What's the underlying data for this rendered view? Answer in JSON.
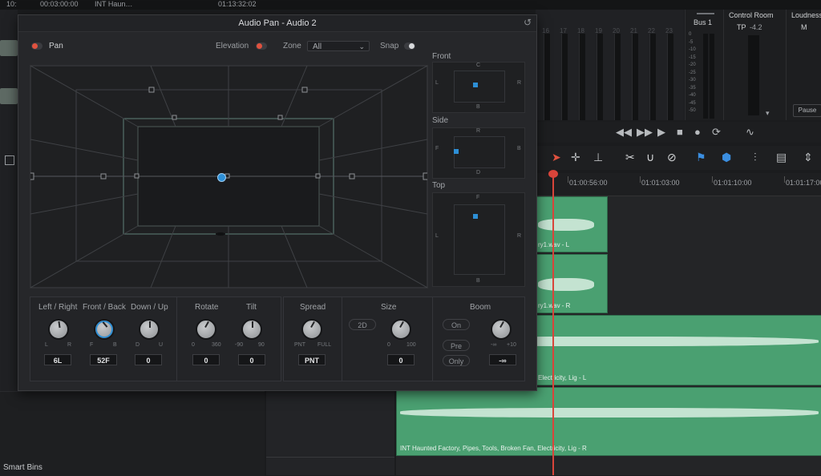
{
  "app": {
    "top_bar": {
      "timecode_a": "10:",
      "timecode_b": "00:03:00:00",
      "clip_name": "INT Haun…",
      "timecode_c": "01:13:32:02"
    },
    "smart_bins": "Smart Bins"
  },
  "panel": {
    "title": "Audio Pan - Audio 2",
    "pan_label": "Pan",
    "elevation_label": "Elevation",
    "zone_label": "Zone",
    "zone_value": "All",
    "snap_label": "Snap",
    "views": {
      "front": {
        "label": "Front",
        "top": "C",
        "left": "L",
        "right": "R",
        "bottom": "B"
      },
      "side": {
        "label": "Side",
        "top": "R",
        "left": "F",
        "right": "B",
        "bottom": "D"
      },
      "top": {
        "label": "Top",
        "top": "F",
        "left": "L",
        "right": "R",
        "bottom": "B"
      }
    },
    "controls": {
      "left_right": {
        "label": "Left / Right",
        "min": "L",
        "max": "R",
        "value": "6L"
      },
      "front_back": {
        "label": "Front / Back",
        "min": "F",
        "max": "B",
        "value": "52F"
      },
      "down_up": {
        "label": "Down / Up",
        "min": "D",
        "max": "U",
        "value": "0"
      },
      "rotate": {
        "label": "Rotate",
        "min": "0",
        "max": "360",
        "value": "0"
      },
      "tilt": {
        "label": "Tilt",
        "min": "-90",
        "max": "90",
        "value": "0"
      },
      "spread": {
        "label": "Spread",
        "min": "PNT",
        "max": "FULL",
        "value": "PNT"
      },
      "size": {
        "label": "Size",
        "mode": "2D",
        "min": "0",
        "max": "100",
        "value": "0"
      },
      "boom": {
        "label": "Boom",
        "on": "On",
        "pre": "Pre",
        "only": "Only",
        "min": "-∞",
        "max": "+10",
        "value": "-∞"
      }
    }
  },
  "mixer": {
    "bus": "Bus 1",
    "control_room": "Control Room",
    "tp_label": "TP",
    "tp_value": "-4.2",
    "loudness": "Loudness",
    "m_label": "M",
    "pause": "Pause",
    "scale": [
      "0",
      "-5",
      "-10",
      "-15",
      "-20",
      "-25",
      "-30",
      "-35",
      "-40",
      "-45",
      "-50"
    ],
    "channel_numbers": [
      "16",
      "17",
      "18",
      "19",
      "20",
      "21",
      "22",
      "23"
    ]
  },
  "timeline": {
    "ruler": [
      "01:00:56:00",
      "01:01:03:00",
      "01:01:10:00",
      "01:01:17:00"
    ],
    "clip_labels": [
      "ry1.wav - L",
      "ry1.wav - R",
      "Electricity, Lig - L",
      "INT Haunted Factory, Pipes, Tools, Broken Fan, Electricity, Lig - R"
    ]
  },
  "colors": {
    "accent_red": "#e0523f",
    "clip_green": "#4aa071",
    "puck_blue": "#2d8fd6",
    "playhead": "#d9453b"
  }
}
